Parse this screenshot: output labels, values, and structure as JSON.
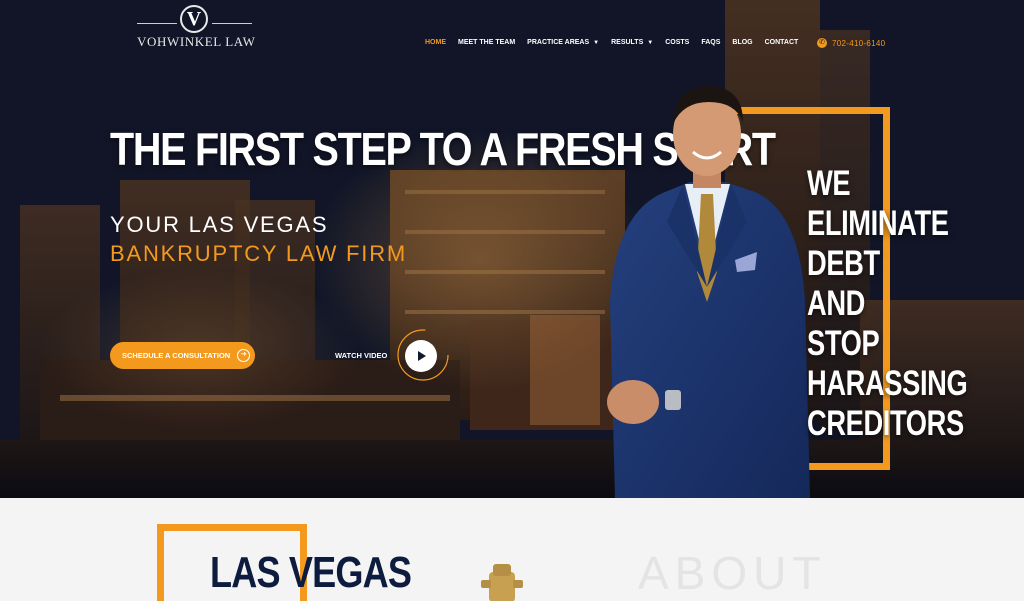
{
  "brand": {
    "logo_letter": "V",
    "name": "VOHWINKEL LAW"
  },
  "nav": {
    "items": [
      {
        "label": "HOME",
        "active": true,
        "dropdown": false
      },
      {
        "label": "MEET THE TEAM",
        "active": false,
        "dropdown": false
      },
      {
        "label": "PRACTICE AREAS",
        "active": false,
        "dropdown": true
      },
      {
        "label": "RESULTS",
        "active": false,
        "dropdown": true
      },
      {
        "label": "COSTS",
        "active": false,
        "dropdown": false
      },
      {
        "label": "FAQS",
        "active": false,
        "dropdown": false
      },
      {
        "label": "BLOG",
        "active": false,
        "dropdown": false
      },
      {
        "label": "CONTACT",
        "active": false,
        "dropdown": false
      }
    ],
    "phone": "702-410-6140",
    "phone_icon": "phone-icon"
  },
  "hero": {
    "headline": "THE FIRST STEP TO A FRESH START",
    "subheading_line1": "YOUR LAS VEGAS",
    "subheading_line2": "BANKRUPTCY LAW FIRM",
    "cta_label": "SCHEDULE A CONSULTATION",
    "cta_icon": "arrow-right-circle-icon",
    "watch_video_label": "WATCH VIDEO",
    "play_icon": "play-icon",
    "tagline": [
      "WE",
      "ELIMINATE",
      "DEBT",
      "AND",
      "STOP",
      "HARASSING",
      "CREDITORS"
    ]
  },
  "lower": {
    "heading": "LAS VEGAS",
    "about": "ABOUT"
  },
  "colors": {
    "accent": "#f39a1e",
    "navy": "#0d1b3f",
    "hero_bg": "#151a2e"
  }
}
